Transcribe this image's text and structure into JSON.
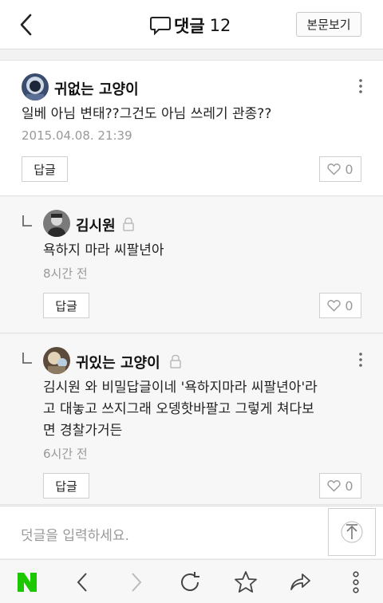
{
  "header": {
    "title": "댓글",
    "count": "12",
    "view_post_label": "본문보기"
  },
  "comments": [
    {
      "author": "귀없는 고양이",
      "text": "일베 아님 변태??그건도 아님 쓰레기 관종??",
      "time": "2015.04.08. 21:39",
      "reply_label": "답글",
      "likes": "0"
    },
    {
      "author": "김시원",
      "text": "욕하지 마라 씨팔년아",
      "time": "8시간 전",
      "reply_label": "답글",
      "likes": "0"
    },
    {
      "author": "귀있는 고양이",
      "text_line1": "김시원 와 비밀답글이네 '욕하지마라 씨팔년아'라",
      "text_line2": "고 대놓고 쓰지그래 오뎅핫바팔고 그렇게 쳐다보",
      "text_line3": "면 경찰가거든",
      "time": "6시간 전",
      "reply_label": "답글",
      "likes": "0"
    }
  ],
  "input": {
    "placeholder": "덧글을 입력하세요."
  },
  "browser_bar": {
    "logo": "N",
    "icons": [
      "back-icon",
      "forward-icon",
      "refresh-icon",
      "star-icon",
      "share-icon",
      "menu-icon"
    ]
  },
  "colors": {
    "naver_green": "#1ec800",
    "muted_text": "#999999"
  }
}
